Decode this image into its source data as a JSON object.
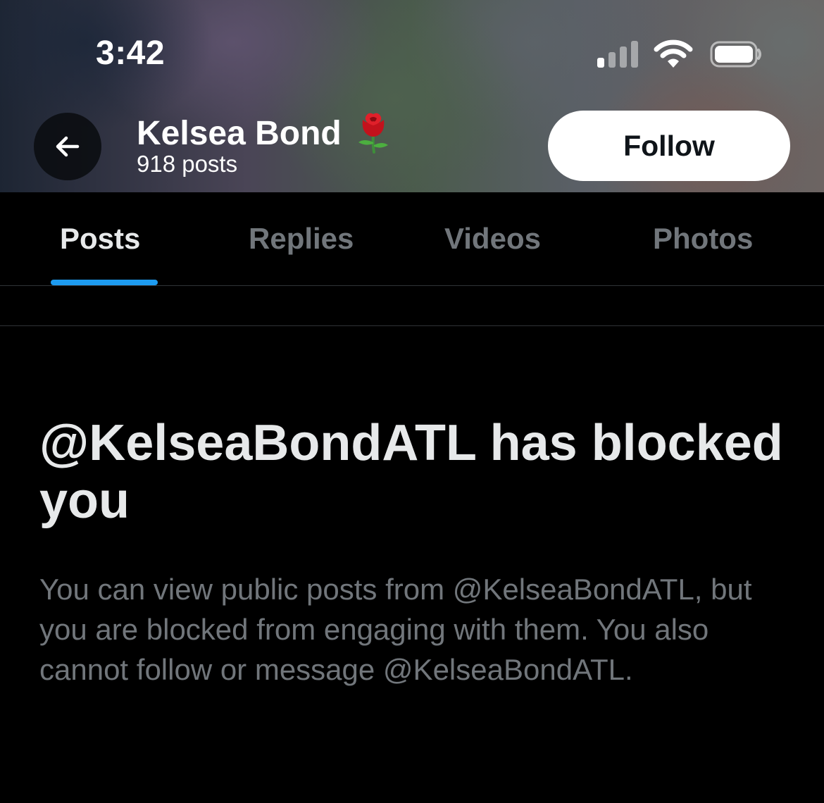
{
  "status_bar": {
    "time": "3:42",
    "signal_icon": "cellular-signal-icon",
    "wifi_icon": "wifi-icon",
    "battery_icon": "battery-icon"
  },
  "header": {
    "back_icon": "arrow-left-icon",
    "name": "Kelsea Bond",
    "name_emoji_icon": "rose-icon",
    "posts_count": "918 posts",
    "follow_label": "Follow"
  },
  "tabs": [
    {
      "label": "Posts",
      "active": true
    },
    {
      "label": "Replies",
      "active": false
    },
    {
      "label": "Videos",
      "active": false
    },
    {
      "label": "Photos",
      "active": false
    }
  ],
  "blocked": {
    "title": "@KelseaBondATL has blocked you",
    "description": "You can view public posts from @KelseaBondATL, but you are blocked from engaging with them. You also cannot follow or message @KelseaBondATL."
  },
  "colors": {
    "background": "#000000",
    "accent": "#1d9bf0",
    "text_primary": "#e7e9ea",
    "text_secondary": "#71767b",
    "follow_button_bg": "#ffffff"
  }
}
